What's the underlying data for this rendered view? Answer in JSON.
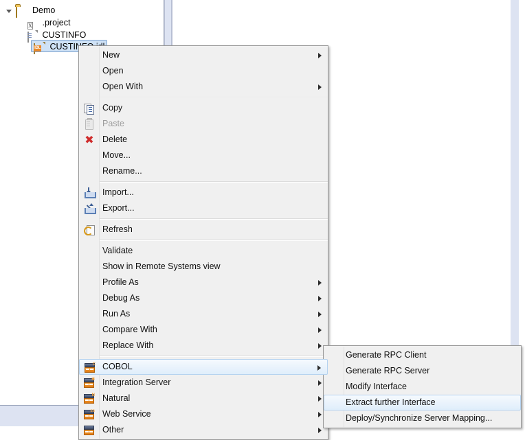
{
  "tree": {
    "items": [
      {
        "label": "Demo",
        "icon": "folder-icon",
        "indent": 0,
        "expander": "expanded",
        "selected": false
      },
      {
        "label": ".project",
        "icon": "xml-file-icon",
        "indent": 1,
        "expander": "none",
        "selected": false
      },
      {
        "label": "CUSTINFO",
        "icon": "text-file-icon",
        "indent": 1,
        "expander": "none",
        "selected": false
      },
      {
        "label": "CUSTINFO.idl",
        "icon": "idl-file-icon",
        "indent": 1,
        "expander": "none",
        "selected": true
      }
    ]
  },
  "context_menu": {
    "groups": [
      {
        "items": [
          {
            "label": "New",
            "icon": "",
            "submenu": true,
            "disabled": false
          },
          {
            "label": "Open",
            "icon": "",
            "submenu": false,
            "disabled": false
          },
          {
            "label": "Open With",
            "icon": "",
            "submenu": true,
            "disabled": false
          }
        ]
      },
      {
        "items": [
          {
            "label": "Copy",
            "icon": "copy-icon",
            "submenu": false,
            "disabled": false
          },
          {
            "label": "Paste",
            "icon": "paste-icon",
            "submenu": false,
            "disabled": true
          },
          {
            "label": "Delete",
            "icon": "delete-icon",
            "submenu": false,
            "disabled": false
          },
          {
            "label": "Move...",
            "icon": "",
            "submenu": false,
            "disabled": false
          },
          {
            "label": "Rename...",
            "icon": "",
            "submenu": false,
            "disabled": false
          }
        ]
      },
      {
        "items": [
          {
            "label": "Import...",
            "icon": "import-icon",
            "submenu": false,
            "disabled": false
          },
          {
            "label": "Export...",
            "icon": "export-icon",
            "submenu": false,
            "disabled": false
          }
        ]
      },
      {
        "items": [
          {
            "label": "Refresh",
            "icon": "refresh-icon",
            "submenu": false,
            "disabled": false
          }
        ]
      },
      {
        "items": [
          {
            "label": "Validate",
            "icon": "",
            "submenu": false,
            "disabled": false
          },
          {
            "label": "Show in Remote Systems view",
            "icon": "",
            "submenu": false,
            "disabled": false
          },
          {
            "label": "Profile As",
            "icon": "",
            "submenu": true,
            "disabled": false
          },
          {
            "label": "Debug As",
            "icon": "",
            "submenu": true,
            "disabled": false
          },
          {
            "label": "Run As",
            "icon": "",
            "submenu": true,
            "disabled": false
          },
          {
            "label": "Compare With",
            "icon": "",
            "submenu": true,
            "disabled": false
          },
          {
            "label": "Replace With",
            "icon": "",
            "submenu": true,
            "disabled": false
          }
        ]
      },
      {
        "items": [
          {
            "label": "COBOL",
            "icon": "generate-cobol-icon",
            "submenu": true,
            "disabled": false,
            "highlighted": true,
            "badge": "C"
          },
          {
            "label": "Integration Server",
            "icon": "generate-is-icon",
            "submenu": true,
            "disabled": false,
            "badge": "✱"
          },
          {
            "label": "Natural",
            "icon": "generate-natural-icon",
            "submenu": true,
            "disabled": false,
            "badge": "N"
          },
          {
            "label": "Web Service",
            "icon": "generate-webservice-icon",
            "submenu": true,
            "disabled": false,
            "badge": "ss"
          },
          {
            "label": "Other",
            "icon": "generate-other-icon",
            "submenu": true,
            "disabled": false,
            "badge": ""
          }
        ]
      }
    ]
  },
  "sub_menu": {
    "items": [
      {
        "label": "Generate RPC Client",
        "highlighted": false
      },
      {
        "label": "Generate RPC Server",
        "highlighted": false
      },
      {
        "label": "Modify Interface",
        "highlighted": false
      },
      {
        "label": "Extract further Interface",
        "highlighted": true
      },
      {
        "label": "Deploy/Synchronize Server Mapping...",
        "highlighted": false
      }
    ]
  },
  "colors": {
    "menu_background": "#f0f0f0",
    "menu_border": "#989898",
    "highlight_border": "#b5d2ef",
    "highlight_fill": "#eaf3fc",
    "tree_selection": "#cfe2f6",
    "panel_background": "#dde3f2",
    "disabled_text": "#9d9d9d",
    "accent_orange": "#e07a12"
  }
}
